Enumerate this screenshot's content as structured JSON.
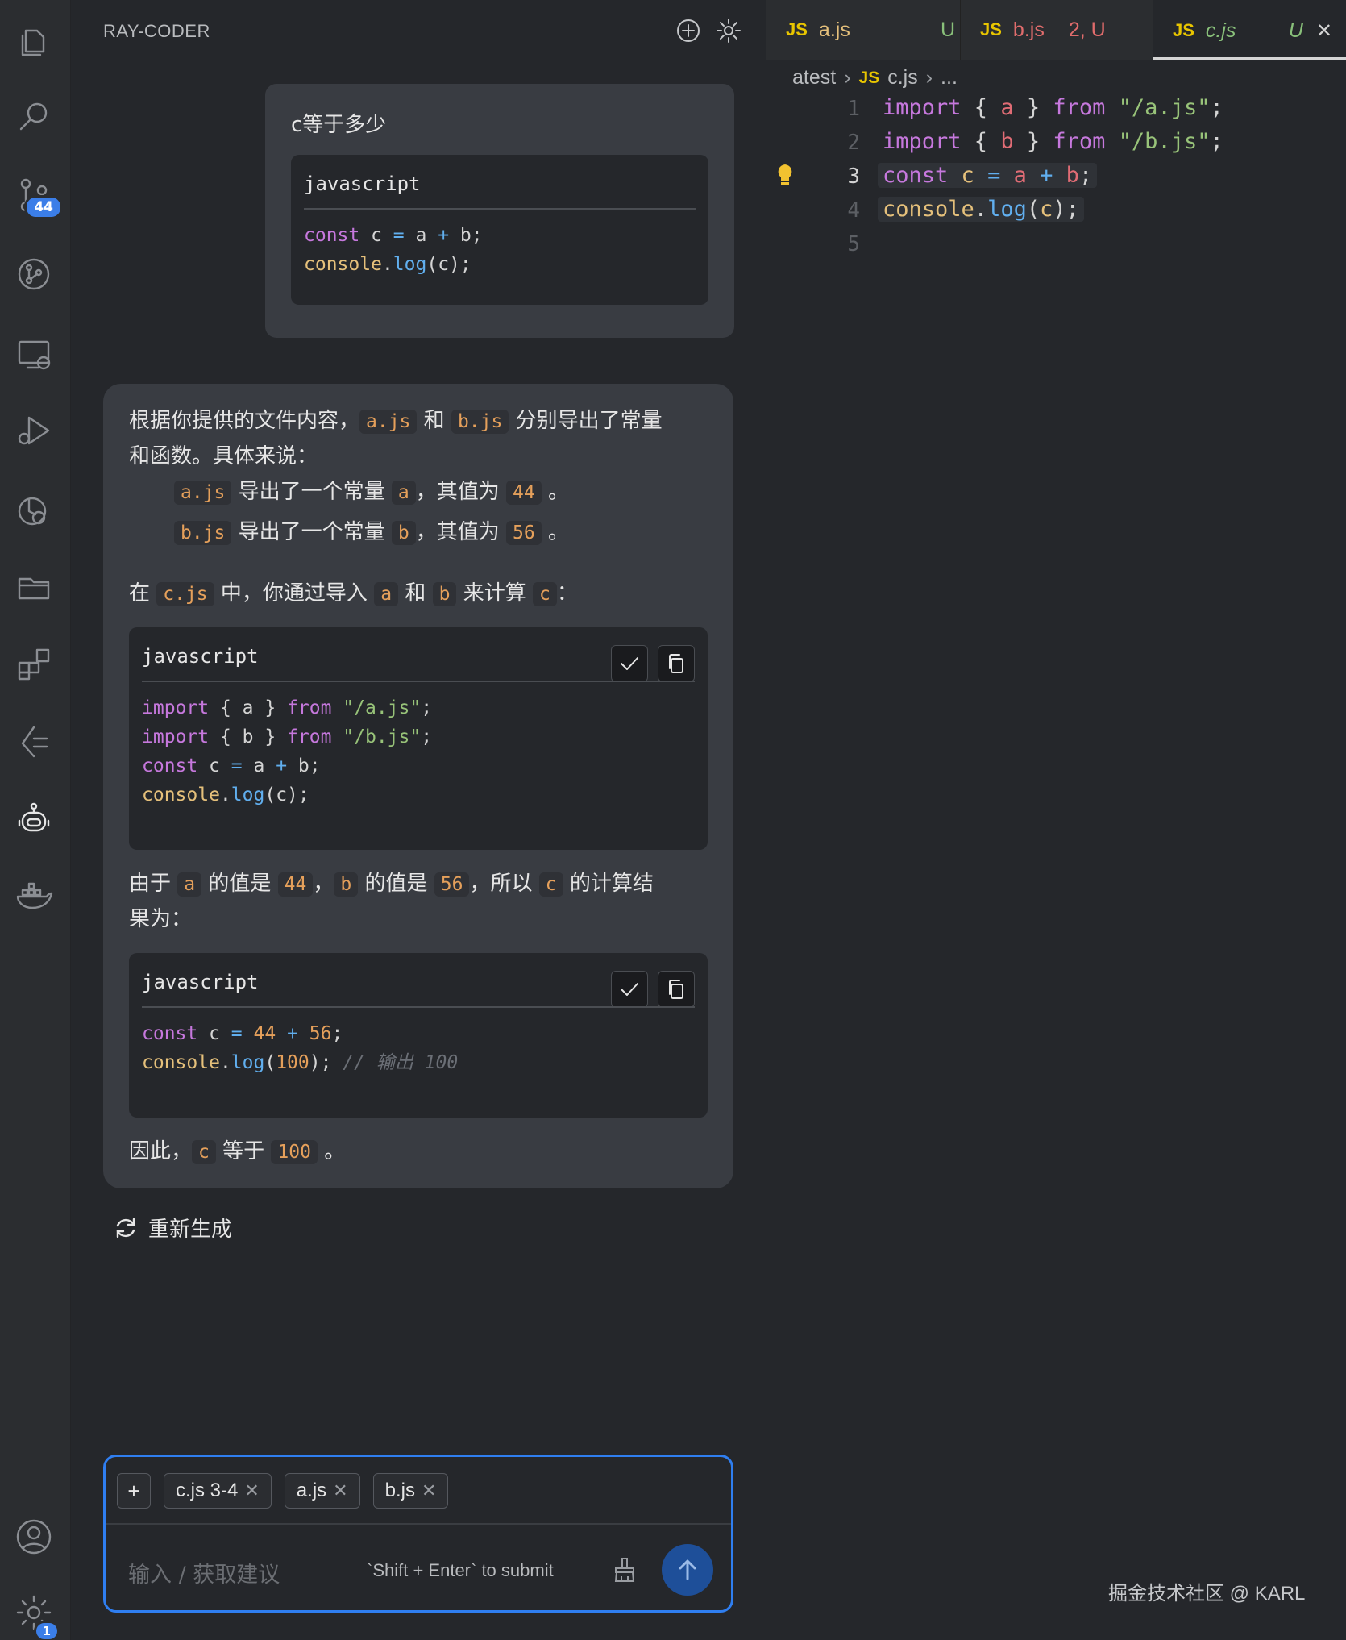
{
  "activity_bar": {
    "scm_badge": "44",
    "settings_badge": "1",
    "items": [
      "explorer-icon",
      "search-icon",
      "source-control-icon",
      "git-graph-icon",
      "remote-explorer-icon",
      "run-debug-icon",
      "testing-icon",
      "folder-icon",
      "extensions-icon",
      "timeline-icon",
      "robot-icon",
      "docker-icon",
      "account-icon",
      "settings-gear-icon"
    ]
  },
  "chat": {
    "title": "RAY-CODER",
    "user_message": {
      "question": "c等于多少",
      "code_lang": "javascript",
      "code": [
        [
          [
            "kw",
            "const"
          ],
          [
            "var",
            " c "
          ],
          [
            "op",
            "="
          ],
          [
            "var",
            " a "
          ],
          [
            "op",
            "+"
          ],
          [
            "var",
            " b;"
          ]
        ],
        [
          [
            "fn",
            "console"
          ],
          [
            "var",
            "."
          ],
          [
            "call",
            "log"
          ],
          [
            "var",
            "(c);"
          ]
        ]
      ]
    },
    "ai_message": {
      "p1_a": "根据你提供的文件内容，",
      "p1_code1": "a.js",
      "p1_b": " 和 ",
      "p1_code2": "b.js",
      "p1_c": " 分别导出了常量",
      "p1_line2": "和函数。具体来说：",
      "li1_code": "a.js",
      "li1_a": " 导出了一个常量 ",
      "li1_var": "a",
      "li1_b": "，其值为 ",
      "li1_val": "44",
      "li1_c": " 。",
      "li2_code": "b.js",
      "li2_a": " 导出了一个常量 ",
      "li2_var": "b",
      "li2_b": "，其值为 ",
      "li2_val": "56",
      "li2_c": " 。",
      "p2_a": "在 ",
      "p2_code": "c.js",
      "p2_b": " 中，你通过导入 ",
      "p2_v1": "a",
      "p2_c": " 和 ",
      "p2_v2": "b",
      "p2_d": " 来计算 ",
      "p2_v3": "c",
      "p2_e": "：",
      "code1_lang": "javascript",
      "code1": [
        [
          [
            "kw",
            "import"
          ],
          [
            "var",
            " { a } "
          ],
          [
            "kw",
            "from"
          ],
          [
            "var",
            " "
          ],
          [
            "str",
            "\"/a.js\""
          ],
          [
            "var",
            ";"
          ]
        ],
        [
          [
            "kw",
            "import"
          ],
          [
            "var",
            " { b } "
          ],
          [
            "kw",
            "from"
          ],
          [
            "var",
            " "
          ],
          [
            "str",
            "\"/b.js\""
          ],
          [
            "var",
            ";"
          ]
        ],
        [
          [
            "kw",
            "const"
          ],
          [
            "var",
            " c "
          ],
          [
            "op",
            "="
          ],
          [
            "var",
            " a "
          ],
          [
            "op",
            "+"
          ],
          [
            "var",
            " b;"
          ]
        ],
        [
          [
            "fn",
            "console"
          ],
          [
            "var",
            "."
          ],
          [
            "call",
            "log"
          ],
          [
            "var",
            "(c);"
          ]
        ]
      ],
      "p3_a": "由于 ",
      "p3_v1": "a",
      "p3_b": " 的值是 ",
      "p3_n1": "44",
      "p3_c": "，",
      "p3_v2": "b",
      "p3_d": " 的值是 ",
      "p3_n2": "56",
      "p3_e": "，所以 ",
      "p3_v3": "c",
      "p3_f": " 的计算结",
      "p3_line2": "果为：",
      "code2_lang": "javascript",
      "code2": [
        [
          [
            "kw",
            "const"
          ],
          [
            "var",
            " c "
          ],
          [
            "op",
            "="
          ],
          [
            "var",
            " "
          ],
          [
            "num",
            "44"
          ],
          [
            "var",
            " "
          ],
          [
            "op",
            "+"
          ],
          [
            "var",
            " "
          ],
          [
            "num",
            "56"
          ],
          [
            "var",
            ";"
          ]
        ],
        [
          [
            "fn",
            "console"
          ],
          [
            "var",
            "."
          ],
          [
            "call",
            "log"
          ],
          [
            "var",
            "("
          ],
          [
            "num",
            "100"
          ],
          [
            "var",
            "); "
          ],
          [
            "cmt",
            "// 输出 100"
          ]
        ]
      ],
      "p4_a": "因此，",
      "p4_v": "c",
      "p4_b": " 等于 ",
      "p4_n": "100",
      "p4_c": " 。"
    },
    "regenerate_label": "重新生成",
    "input": {
      "chips": [
        "c.js 3-4",
        "a.js",
        "b.js"
      ],
      "placeholder": "输入 / 获取建议",
      "hint": "`Shift + Enter` to submit"
    }
  },
  "editor": {
    "tabs": [
      {
        "icon": "JS",
        "name": "a.js",
        "status": "U",
        "name_color": "#e5c07b",
        "status_color": "#89c07a"
      },
      {
        "icon": "JS",
        "name": "b.js",
        "status": "2, U",
        "name_color": "#e06c6c",
        "status_color": "#e06c6c"
      },
      {
        "icon": "JS",
        "name": "c.js",
        "status": "U",
        "name_color": "#89c07a",
        "status_color": "#89c07a"
      }
    ],
    "breadcrumb": {
      "folder": "atest",
      "icon": "JS",
      "file": "c.js",
      "more": "..."
    },
    "lines": [
      {
        "n": "1",
        "tokens": [
          [
            "kw",
            "import"
          ],
          [
            "var",
            " { "
          ],
          [
            "vr",
            "a"
          ],
          [
            "var",
            " } "
          ],
          [
            "kw",
            "from"
          ],
          [
            "var",
            " "
          ],
          [
            "str",
            "\"/a.js\""
          ],
          [
            "var",
            ";"
          ]
        ]
      },
      {
        "n": "2",
        "tokens": [
          [
            "kw",
            "import"
          ],
          [
            "var",
            " { "
          ],
          [
            "vr",
            "b"
          ],
          [
            "var",
            " } "
          ],
          [
            "kw",
            "from"
          ],
          [
            "var",
            " "
          ],
          [
            "str",
            "\"/b.js\""
          ],
          [
            "var",
            ";"
          ]
        ]
      },
      {
        "n": "3",
        "tokens": [
          [
            "kw",
            "const"
          ],
          [
            "var",
            " "
          ],
          [
            "fn",
            "c"
          ],
          [
            "var",
            " "
          ],
          [
            "op",
            "="
          ],
          [
            "var",
            " "
          ],
          [
            "vr",
            "a"
          ],
          [
            "var",
            " "
          ],
          [
            "op",
            "+"
          ],
          [
            "var",
            " "
          ],
          [
            "vr",
            "b"
          ],
          [
            "var",
            ";"
          ]
        ]
      },
      {
        "n": "4",
        "tokens": [
          [
            "fn",
            "console"
          ],
          [
            "var",
            "."
          ],
          [
            "call",
            "log"
          ],
          [
            "var",
            "("
          ],
          [
            "fn",
            "c"
          ],
          [
            "var",
            ");"
          ]
        ]
      },
      {
        "n": "5",
        "tokens": []
      }
    ],
    "current_line": "3"
  },
  "watermark": "掘金技术社区 @ KARL"
}
